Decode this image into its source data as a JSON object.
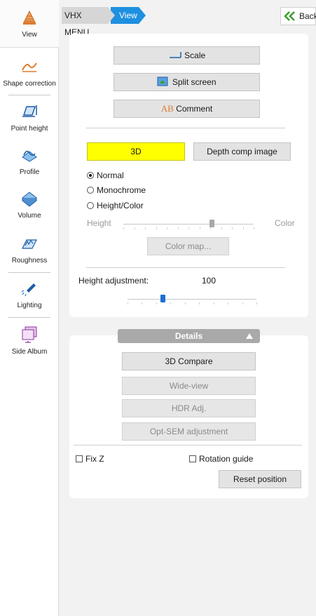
{
  "sidebar": {
    "items": [
      {
        "label": "View"
      },
      {
        "label": "Shape correction"
      },
      {
        "label": "Point height"
      },
      {
        "label": "Profile"
      },
      {
        "label": "Volume"
      },
      {
        "label": "Roughness"
      },
      {
        "label": "Lighting"
      },
      {
        "label": "Side Album"
      }
    ]
  },
  "breadcrumb": {
    "root": "VHX MENU",
    "current": "View",
    "back_label": "Back"
  },
  "tools": {
    "scale_label": "Scale",
    "split_label": "Split screen",
    "comment_label": "Comment",
    "comment_glyph": "AB"
  },
  "mode": {
    "threed_label": "3D",
    "depth_label": "Depth comp image"
  },
  "display": {
    "normal": "Normal",
    "monochrome": "Monochrome",
    "heightcolor": "Height/Color",
    "selected": "Normal",
    "slider_left": "Height",
    "slider_right": "Color",
    "slider_value_fraction": 0.68,
    "colormap_label": "Color map..."
  },
  "height_adjustment": {
    "label": "Height adjustment:",
    "value": "100",
    "slider_value_fraction": 0.27
  },
  "details": {
    "title": "Details",
    "compare": "3D Compare",
    "wideview": "Wide-view",
    "hdr": "HDR Adj.",
    "optsem": "Opt-SEM adjustment",
    "fixz": "Fix Z",
    "rotation": "Rotation guide",
    "reset": "Reset position"
  },
  "colors": {
    "accent": "#1e90e0",
    "threed_bg": "#ffff00",
    "back_arrow": "#3a9e2c"
  }
}
